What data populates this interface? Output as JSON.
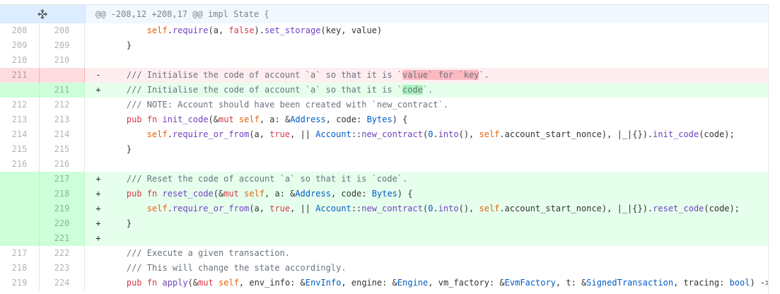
{
  "hunk": {
    "header": "@@ -208,12 +208,17 @@ impl State {",
    "expand_icon": "expand-icon"
  },
  "lines": [
    {
      "type": "ctx",
      "old": "208",
      "new": "208",
      "marker": " ",
      "text": "        self.require(a, false).set_storage(key, value)"
    },
    {
      "type": "ctx",
      "old": "209",
      "new": "209",
      "marker": " ",
      "text": "    }"
    },
    {
      "type": "ctx",
      "old": "210",
      "new": "210",
      "marker": " ",
      "text": ""
    },
    {
      "type": "del",
      "old": "211",
      "new": "",
      "marker": "-",
      "text": "    /// Initialise the code of account `a` so that it is `value` for `key`."
    },
    {
      "type": "add",
      "old": "",
      "new": "211",
      "marker": "+",
      "text": "    /// Initialise the code of account `a` so that it is `code`."
    },
    {
      "type": "ctx",
      "old": "212",
      "new": "212",
      "marker": " ",
      "text": "    /// NOTE: Account should have been created with `new_contract`."
    },
    {
      "type": "ctx",
      "old": "213",
      "new": "213",
      "marker": " ",
      "text": "    pub fn init_code(&mut self, a: &Address, code: Bytes) {"
    },
    {
      "type": "ctx",
      "old": "214",
      "new": "214",
      "marker": " ",
      "text": "        self.require_or_from(a, true, || Account::new_contract(0.into(), self.account_start_nonce), |_|{}).init_code(code);"
    },
    {
      "type": "ctx",
      "old": "215",
      "new": "215",
      "marker": " ",
      "text": "    }"
    },
    {
      "type": "ctx",
      "old": "216",
      "new": "216",
      "marker": " ",
      "text": ""
    },
    {
      "type": "add",
      "old": "",
      "new": "217",
      "marker": "+",
      "text": "    /// Reset the code of account `a` so that it is `code`."
    },
    {
      "type": "add",
      "old": "",
      "new": "218",
      "marker": "+",
      "text": "    pub fn reset_code(&mut self, a: &Address, code: Bytes) {"
    },
    {
      "type": "add",
      "old": "",
      "new": "219",
      "marker": "+",
      "text": "        self.require_or_from(a, true, || Account::new_contract(0.into(), self.account_start_nonce), |_|{}).reset_code(code);"
    },
    {
      "type": "add",
      "old": "",
      "new": "220",
      "marker": "+",
      "text": "    }"
    },
    {
      "type": "add",
      "old": "",
      "new": "221",
      "marker": "+",
      "text": ""
    },
    {
      "type": "ctx",
      "old": "217",
      "new": "222",
      "marker": " ",
      "text": "    /// Execute a given transaction."
    },
    {
      "type": "ctx",
      "old": "218",
      "new": "223",
      "marker": " ",
      "text": "    /// This will change the state accordingly."
    },
    {
      "type": "ctx",
      "old": "219",
      "new": "224",
      "marker": " ",
      "text": "    pub fn apply(&mut self, env_info: &EnvInfo, engine: &Engine, vm_factory: &EvmFactory, t: &SignedTransaction, tracing: bool) -> A"
    }
  ]
}
